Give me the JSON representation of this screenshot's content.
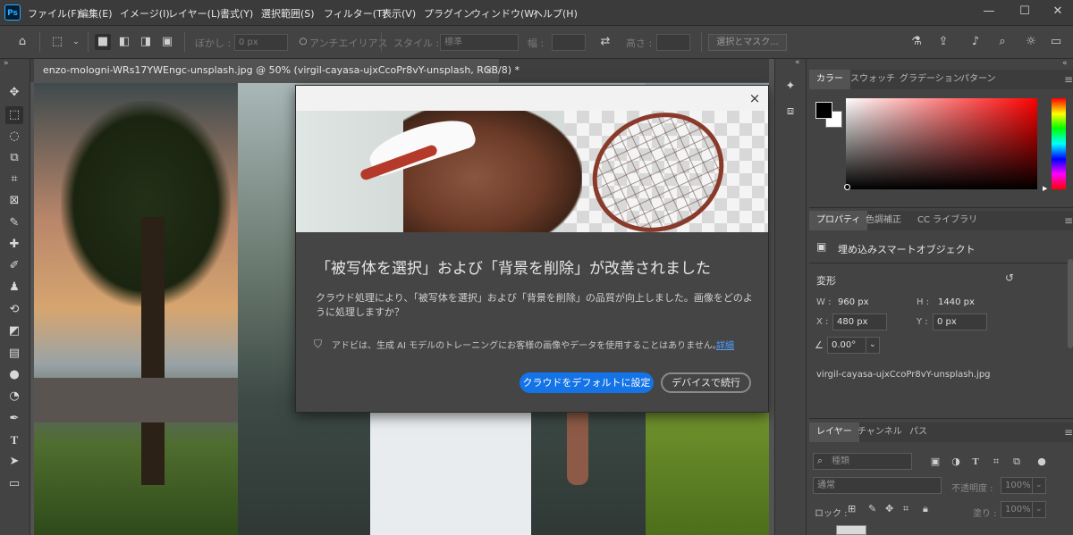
{
  "app": {
    "logo": "Ps"
  },
  "menu": [
    "ファイル(F)",
    "編集(E)",
    "イメージ(I)",
    "レイヤー(L)",
    "書式(Y)",
    "選択範囲(S)",
    "フィルター(T)",
    "表示(V)",
    "プラグイン",
    "ウィンドウ(W)",
    "ヘルプ(H)"
  ],
  "options_bar": {
    "feather_label": "ぼかし :",
    "feather_value": "0 px",
    "antialias_label": "アンチエイリアス",
    "style_label": "スタイル :",
    "style_value": "標準",
    "width_label": "幅 :",
    "height_label": "高さ :",
    "select_mask_label": "選択とマスク..."
  },
  "document": {
    "tab_title": "enzo-mologni-WRs17YWEngc-unsplash.jpg @ 50% (virgil-cayasa-ujxCcoPr8vY-unsplash, RGB/8) *",
    "tab_close": "×"
  },
  "dialog": {
    "title": "「被写体を選択」および「背景を削除」が改善されました",
    "body": "クラウド処理により、「被写体を選択」および「背景を削除」の品質が向上しました。画像をどのように処理しますか？",
    "note": "アドビは、生成 AI モデルのトレーニングにお客様の画像やデータを使用することはありません。",
    "note_link": "詳細",
    "primary_button": "クラウドをデフォルトに設定",
    "secondary_button": "デバイスで続行",
    "close": "×"
  },
  "color_panel": {
    "tabs": [
      "カラー",
      "スウォッチ",
      "グラデーション",
      "パターン"
    ],
    "foreground": "#000000",
    "background": "#ffffff"
  },
  "properties_panel": {
    "tabs": [
      "プロパティ",
      "色調補正",
      "CC ライブラリ"
    ],
    "object_type": "埋め込みスマートオブジェクト",
    "transform_label": "変形",
    "w_label": "W :",
    "w_value": "960 px",
    "h_label": "H :",
    "h_value": "1440 px",
    "x_label": "X :",
    "x_value": "480 px",
    "y_label": "Y :",
    "y_value": "0 px",
    "angle_value": "0.00°",
    "filename": "virgil-cayasa-ujxCcoPr8vY-unsplash.jpg"
  },
  "layers_panel": {
    "tabs": [
      "レイヤー",
      "チャンネル",
      "パス"
    ],
    "search_placeholder": "種類",
    "blend_mode": "通常",
    "opacity_label": "不透明度 :",
    "opacity_value": "100%",
    "lock_label": "ロック :",
    "fill_label": "塗り :",
    "fill_value": "100%"
  },
  "colors": {
    "accent": "#1473e6",
    "link": "#4e9fff",
    "ui_bg": "#434343"
  }
}
